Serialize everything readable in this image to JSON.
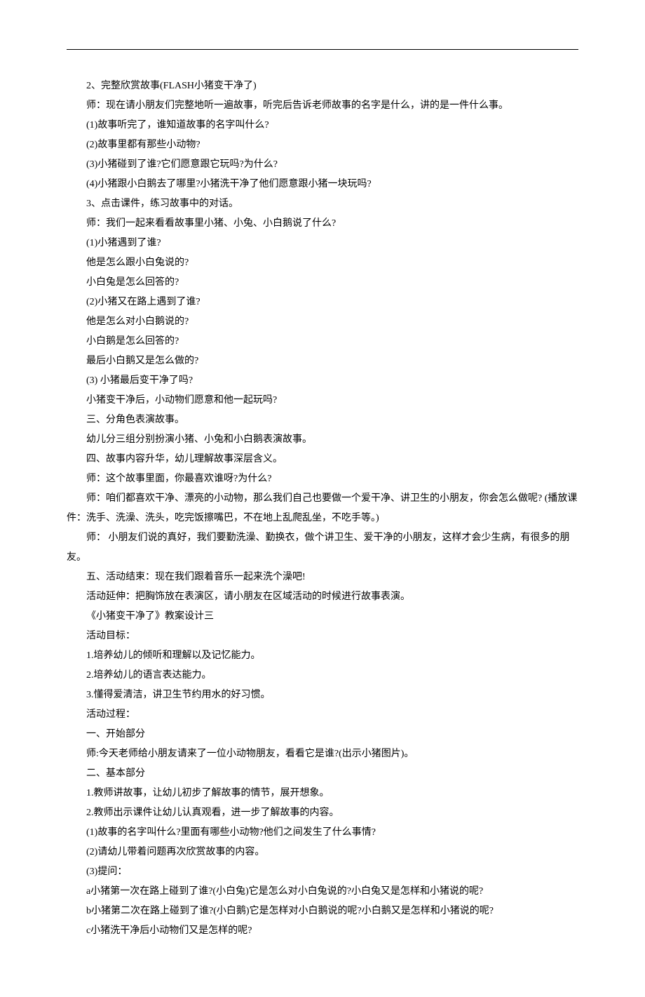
{
  "lines": [
    "2、完整欣赏故事(FLASH小猪变干净了)",
    "师：现在请小朋友们完整地听一遍故事，听完后告诉老师故事的名字是什么，讲的是一件什么事。",
    "(1)故事听完了，谁知道故事的名字叫什么?",
    "(2)故事里都有那些小动物?",
    "(3)小猪碰到了谁?它们愿意跟它玩吗?为什么?",
    "(4)小猪跟小白鹅去了哪里?小猪洗干净了他们愿意跟小猪一块玩吗?",
    "3、点击课件，练习故事中的对话。",
    "师：我们一起来看看故事里小猪、小兔、小白鹅说了什么?",
    "(1)小猪遇到了谁?",
    "他是怎么跟小白兔说的?",
    "小白兔是怎么回答的?",
    "(2)小猪又在路上遇到了谁?",
    "他是怎么对小白鹅说的?",
    "小白鹅是怎么回答的?",
    "最后小白鹅又是怎么做的?",
    "(3)  小猪最后变干净了吗?",
    "小猪变干净后，小动物们愿意和他一起玩吗?",
    "三、分角色表演故事。",
    "幼儿分三组分别扮演小猪、小兔和小白鹅表演故事。",
    "四、故事内容升华，幼儿理解故事深层含义。",
    "师：这个故事里面，你最喜欢谁呀?为什么?",
    "师：咱们都喜欢干净、漂亮的小动物，那么我们自己也要做一个爱干净、讲卫生的小朋友，你会怎么做呢? (播放课件：洗手、洗澡、洗头，吃完饭擦嘴巴，不在地上乱爬乱坐，不吃手等。)",
    "师：  小朋友们说的真好，我们要勤洗澡、勤换衣，做个讲卫生、爱干净的小朋友，这样才会少生病，有很多的朋友。",
    "五、活动结束：现在我们跟着音乐一起来洗个澡吧!",
    "活动延伸：把胸饰放在表演区，请小朋友在区域活动的时候进行故事表演。",
    "《小猪变干净了》教案设计三",
    "活动目标：",
    "1.培养幼儿的倾听和理解以及记忆能力。",
    "2.培养幼儿的语言表达能力。",
    "3.懂得爱清洁，讲卫生节约用水的好习惯。",
    "活动过程：",
    "一、开始部分",
    "师:今天老师给小朋友请来了一位小动物朋友，看看它是谁?(出示小猪图片)。",
    "二、基本部分",
    "1.教师讲故事，让幼儿初步了解故事的情节，展开想象。",
    "2.教师出示课件让幼儿认真观看，进一步了解故事的内容。",
    "(1)故事的名字叫什么?里面有哪些小动物?他们之间发生了什么事情?",
    "(2)请幼儿带着问题再次欣赏故事的内容。",
    "(3)提问：",
    "a小猪第一次在路上碰到了谁?(小白兔)它是怎么对小白兔说的?小白兔又是怎样和小猪说的呢?",
    "b小猪第二次在路上碰到了谁?(小白鹅)它是怎样对小白鹅说的呢?小白鹅又是怎样和小猪说的呢?",
    "c小猪洗干净后小动物们又是怎样的呢?"
  ]
}
